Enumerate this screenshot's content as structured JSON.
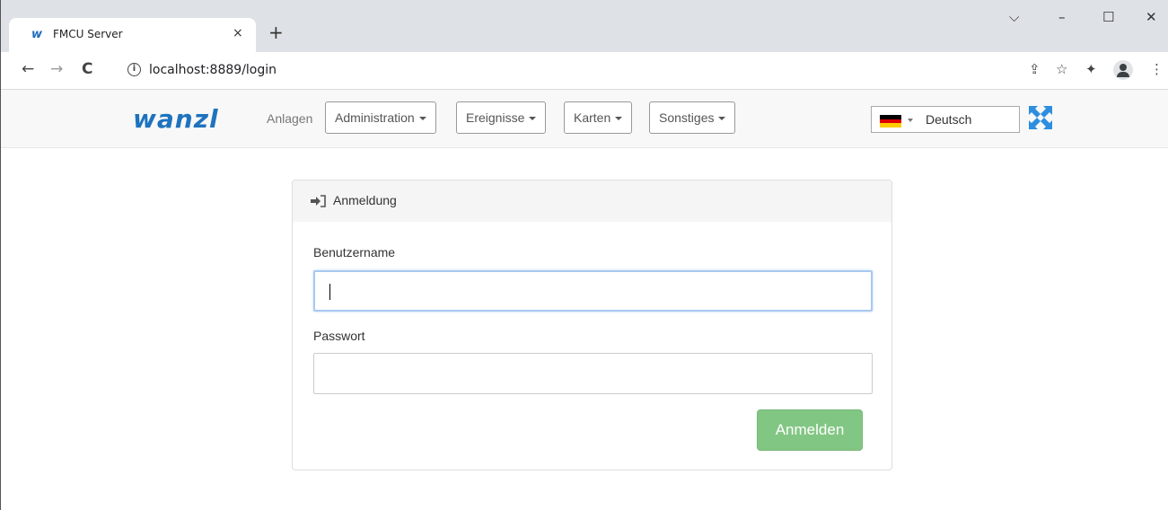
{
  "browser": {
    "tab_title": "FMCU Server",
    "favicon_text": "w",
    "tab_close": "×",
    "new_tab": "+",
    "url": "localhost:8889/login",
    "window_controls": {
      "chevron": "⌵",
      "minimize": "–",
      "maximize": "☐",
      "close": "✕"
    },
    "nav": {
      "back": "←",
      "forward": "→",
      "reload": "C"
    },
    "toolbar_icons": {
      "share": "⇪",
      "star": "☆",
      "extensions": "✦",
      "menu": "⋮"
    }
  },
  "navbar": {
    "brand": "wanzl",
    "link_anlagen": "Anlagen",
    "dropdowns": [
      "Administration",
      "Ereignisse",
      "Karten",
      "Sonstiges"
    ],
    "language": "Deutsch",
    "flag_colors": [
      "#000000",
      "#dd0000",
      "#ffce00"
    ],
    "fullscreen_color": "#2d8ee0"
  },
  "login": {
    "heading": "Anmeldung",
    "username_label": "Benutzername",
    "username_value": "",
    "password_label": "Passwort",
    "password_value": "",
    "submit_label": "Anmelden",
    "submit_color": "#82c683"
  }
}
